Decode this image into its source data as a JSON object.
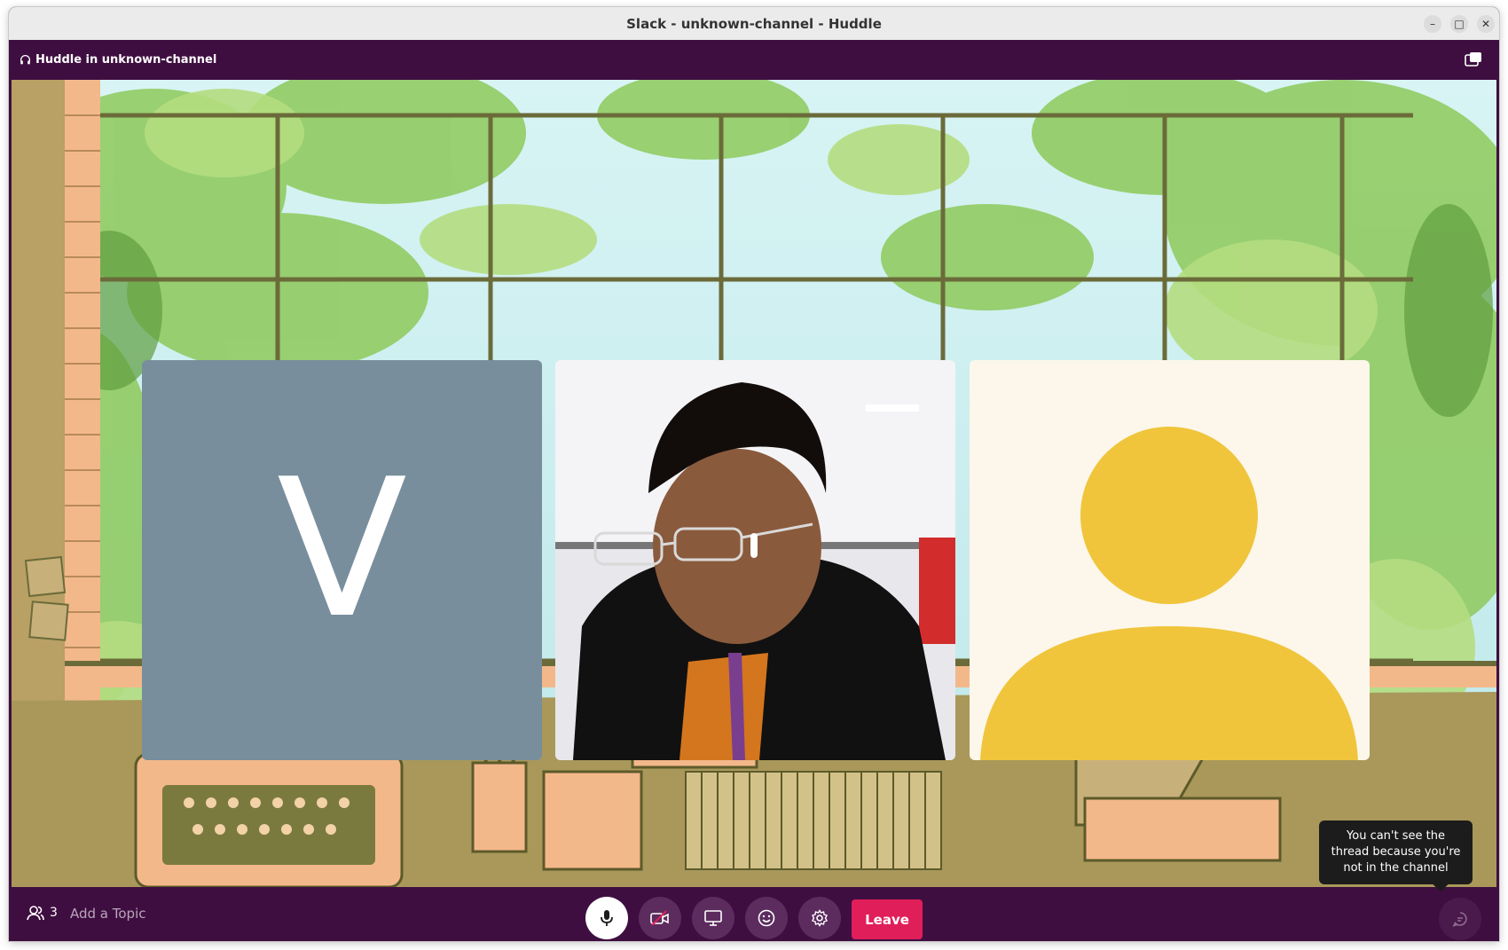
{
  "window": {
    "title": "Slack - unknown-channel - Huddle",
    "controls": {
      "minimize": "–",
      "maximize": "□",
      "close": "✕"
    }
  },
  "header": {
    "label": "Huddle in unknown-channel",
    "icon": "headphones-icon",
    "popout_icon": "popout-window-icon"
  },
  "participants_tiles": [
    {
      "type": "initial",
      "initial": "V",
      "color": "#788e9c"
    },
    {
      "type": "video"
    },
    {
      "type": "avatar",
      "color": "#f0c53c"
    }
  ],
  "bottom_bar": {
    "participant_count": "3",
    "add_topic": "Add a Topic",
    "controls": [
      "microphone-icon",
      "camera-off-icon",
      "screen-share-icon",
      "emoji-icon",
      "settings-gear-icon"
    ],
    "leave_label": "Leave",
    "thread_icon": "thread-icon"
  },
  "tooltip": {
    "text": "You can't see the thread because you're not in the channel"
  },
  "colors": {
    "aubergine": "#3f0e40",
    "leave": "#e01e5a",
    "avatar_yellow": "#f0c53c"
  }
}
